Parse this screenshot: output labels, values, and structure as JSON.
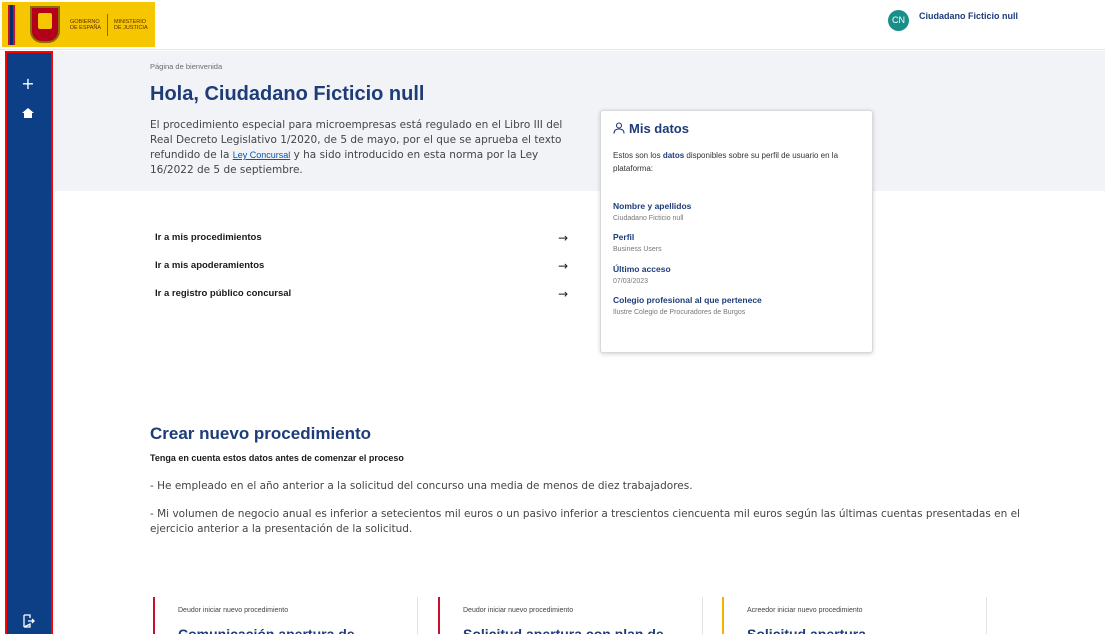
{
  "header": {
    "logo_gov": "GOBIERNO DE ESPAÑA",
    "logo_ministry": "MINISTERIO DE JUSTICIA",
    "user_initials": "CN",
    "user_name": "Ciudadano Ficticio null"
  },
  "sidebar": {
    "icons": [
      "plus-icon",
      "home-icon",
      "logout-icon"
    ]
  },
  "breadcrumb": "Página de bienvenida",
  "title": "Hola, Ciudadano Ficticio null",
  "intro": {
    "part1": "El procedimiento especial para microempresas está regulado en el Libro III del Real Decreto Legislativo 1/2020, de 5 de mayo, por el que se aprueba el texto refundido de la ",
    "link": "Ley Concursal",
    "part2": " y ha sido introducido en esta norma por la Ley 16/2022 de 5 de septiembre."
  },
  "links": [
    {
      "label": "Ir a mis procedimientos",
      "arrow": "→"
    },
    {
      "label": "Ir a mis apoderamientos",
      "arrow": "→"
    },
    {
      "label": "Ir a registro público concursal",
      "arrow": "→"
    }
  ],
  "mis_datos": {
    "title": "Mis datos",
    "desc_pre": "Estos son los ",
    "desc_bold": "datos",
    "desc_post": " disponibles sobre su perfil de usuario en la plataforma:",
    "fields": [
      {
        "label": "Nombre y apellidos",
        "value": "Ciudadano Ficticio null"
      },
      {
        "label": "Perfil",
        "value": "Business Users"
      },
      {
        "label": "Último acceso",
        "value": "07/03/2023"
      },
      {
        "label": "Colegio profesional al que pertenece",
        "value": "Ilustre Colegio de Procuradores de Burgos"
      }
    ]
  },
  "crear": {
    "title": "Crear nuevo procedimiento",
    "subtitle": "Tenga en cuenta estos datos antes de comenzar el proceso",
    "bullets": [
      "- He empleado en el año anterior a la solicitud del concurso una media de menos de diez trabajadores.",
      "- Mi volumen de negocio  anual es inferior a setecientos mil  euros o un pasivo inferior a trescientos ciencuenta mil  euros según las últimas cuentas presentadas en el ejercicio anterior a la presentación de la solicitud."
    ]
  },
  "proc_cards": [
    {
      "label": "Deudor iniciar nuevo procedimiento",
      "title": "Comunicación apertura de",
      "accent": "#c8102e"
    },
    {
      "label": "Deudor iniciar nuevo procedimiento",
      "title": "Solicitud apertura con plan de",
      "accent": "#c8102e"
    },
    {
      "label": "Acreedor iniciar nuevo procedimiento",
      "title": "Solicitud apertura",
      "accent": "#f0b400"
    }
  ],
  "colors": {
    "primary": "#1d3c78",
    "sidebar": "#0c3f86",
    "avatar": "#1a8f8a"
  }
}
